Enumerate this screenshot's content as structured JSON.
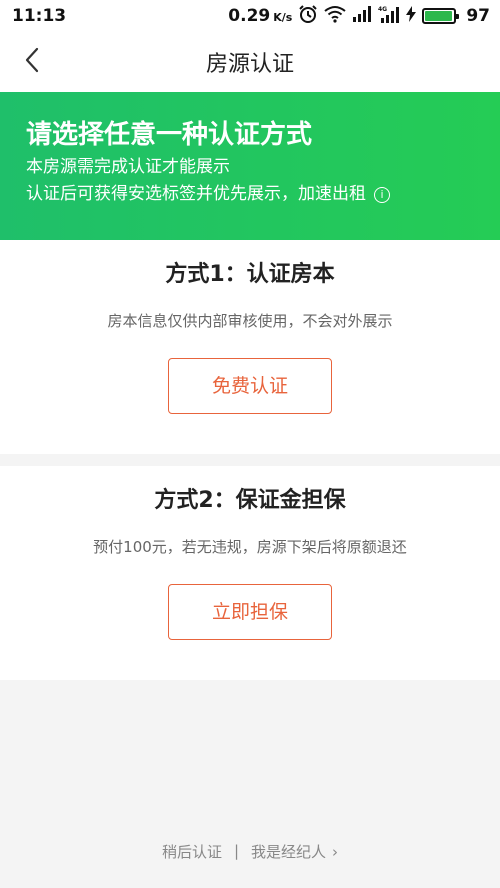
{
  "status_bar": {
    "time": "11:13",
    "net_speed": "0.29",
    "net_unit": "K/s",
    "battery_level": "97",
    "battery_fraction": 0.97,
    "icons": [
      "alarm-icon",
      "wifi-icon",
      "signal-icon",
      "signal-4g-icon",
      "charging-icon",
      "battery-icon"
    ]
  },
  "nav": {
    "title": "房源认证",
    "back_icon": "chevron-left-icon"
  },
  "banner": {
    "title": "请选择任意一种认证方式",
    "line1": "本房源需完成认证才能展示",
    "line2": "认证后可获得安选标签并优先展示，加速出租",
    "info_icon": "i"
  },
  "methods": [
    {
      "title": "方式1：认证房本",
      "desc": "房本信息仅供内部审核使用，不会对外展示",
      "button": "免费认证"
    },
    {
      "title": "方式2：保证金担保",
      "desc": "预付100元，若无违规，房源下架后将原额退还",
      "button": "立即担保"
    }
  ],
  "footer": {
    "later": "稍后认证",
    "separator": "|",
    "agent": "我是经纪人",
    "chevron": "›"
  },
  "colors": {
    "banner_start": "#1fbf6a",
    "banner_end": "#25cc55",
    "accent": "#e8643c",
    "battery": "#2db84d"
  }
}
